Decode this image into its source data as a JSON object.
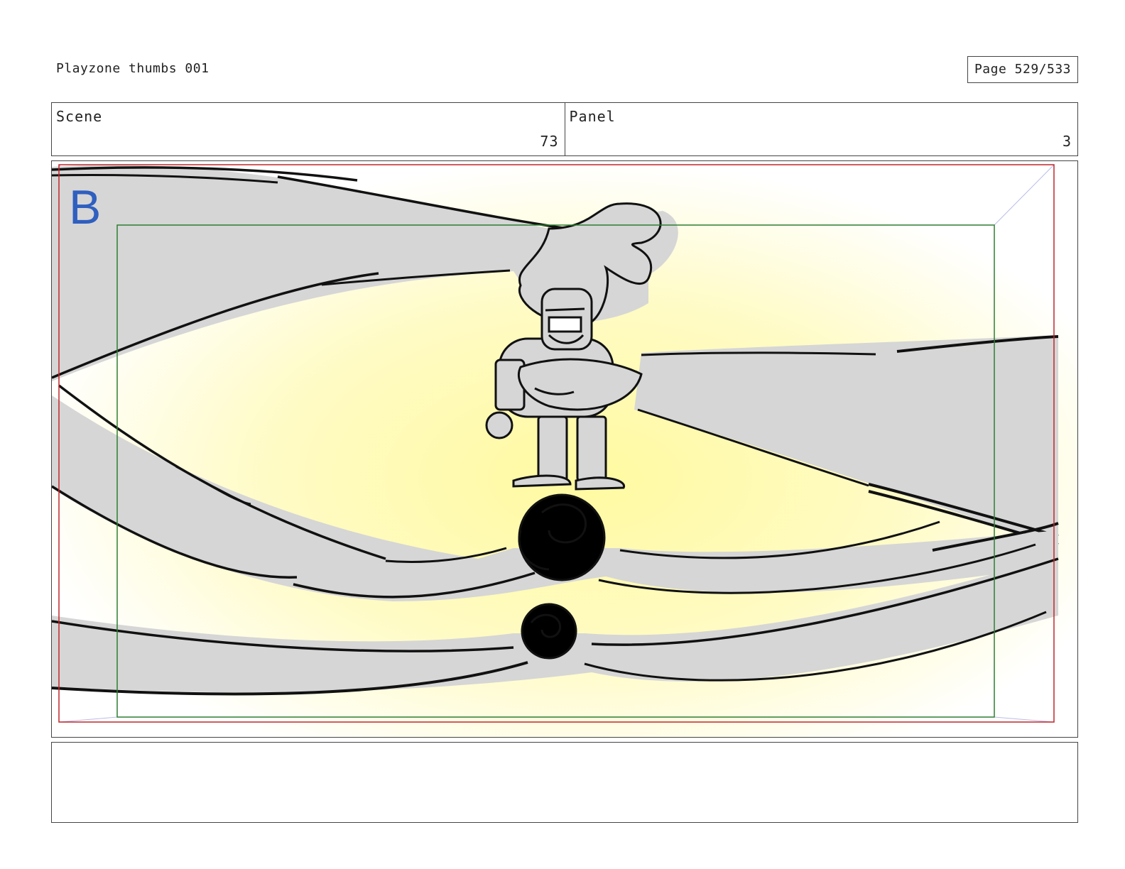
{
  "header": {
    "title": "Playzone thumbs 001",
    "page_label": "Page 529/533"
  },
  "info": {
    "scene_label": "Scene",
    "scene_value": "73",
    "panel_label": "Panel",
    "panel_value": "3"
  },
  "panel": {
    "marker": "B",
    "marker_color": "#2f5fbf",
    "safe_frame_color": "#c0262c",
    "title_safe_color": "#2e7d32",
    "glow_color": "#fffaa0",
    "limb_color": "#d6d6d6"
  },
  "notes": {
    "text": ""
  }
}
